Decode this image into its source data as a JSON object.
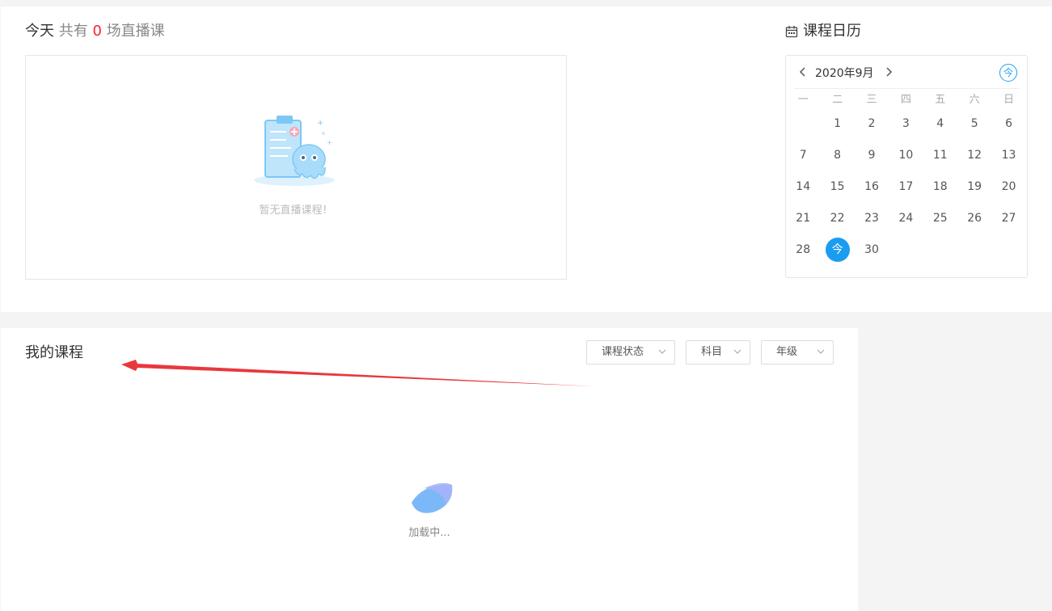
{
  "today": {
    "label": "今天",
    "prefix": "共有",
    "count": "0",
    "suffix": "场直播课"
  },
  "empty": {
    "text": "暂无直播课程！"
  },
  "calendar": {
    "title": "课程日历",
    "month": "2020年9月",
    "today_btn": "今",
    "weekdays": [
      "一",
      "二",
      "三",
      "四",
      "五",
      "六",
      "日"
    ],
    "weeks": [
      [
        "",
        "1",
        "2",
        "3",
        "4",
        "5",
        "6"
      ],
      [
        "7",
        "8",
        "9",
        "10",
        "11",
        "12",
        "13"
      ],
      [
        "14",
        "15",
        "16",
        "17",
        "18",
        "19",
        "20"
      ],
      [
        "21",
        "22",
        "23",
        "24",
        "25",
        "26",
        "27"
      ],
      [
        "28",
        "今",
        "30",
        "",
        "",
        "",
        ""
      ]
    ],
    "accent": "#1a9cf0"
  },
  "courses": {
    "title": "我的课程",
    "filters": {
      "status": "课程状态",
      "subject": "科目",
      "grade": "年级"
    },
    "loading": "加载中..."
  },
  "colors": {
    "highlight": "#f5222d",
    "annotation_arrow": "#e8383d"
  }
}
